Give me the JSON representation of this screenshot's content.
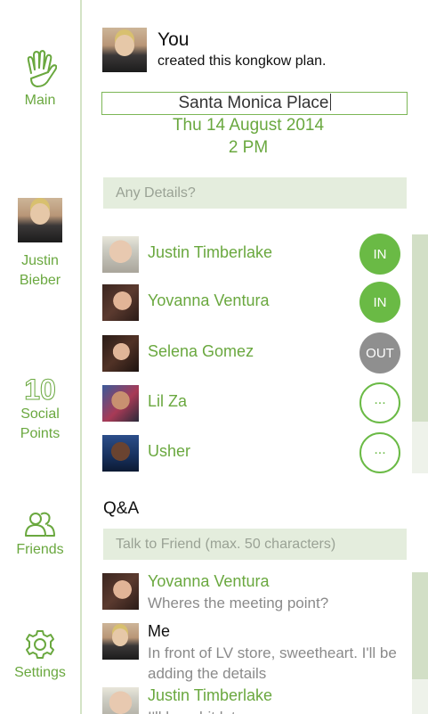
{
  "sidebar": {
    "main": {
      "label": "Main",
      "icon": "hand-icon"
    },
    "profile": {
      "name_line1": "Justin",
      "name_line2": "Bieber"
    },
    "points": {
      "value": "10",
      "label_line1": "Social",
      "label_line2": "Points"
    },
    "friends": {
      "label": "Friends",
      "icon": "friends-icon"
    },
    "settings": {
      "label": "Settings",
      "icon": "gear-icon"
    }
  },
  "creator": {
    "name": "You",
    "action": "created this kongkow plan."
  },
  "plan": {
    "place": "Santa Monica Place",
    "date": "Thu 14 August 2014",
    "time": "2 PM",
    "details_placeholder": "Any Details?"
  },
  "friends": [
    {
      "name": "Justin Timberlake",
      "status": "IN"
    },
    {
      "name": "Yovanna Ventura",
      "status": "IN"
    },
    {
      "name": "Selena Gomez",
      "status": "OUT"
    },
    {
      "name": "Lil Za",
      "status": "..."
    },
    {
      "name": "Usher",
      "status": "..."
    }
  ],
  "qa": {
    "title": "Q&A",
    "input_placeholder": "Talk to Friend (max. 50 characters)",
    "messages": [
      {
        "author": "Yovanna Ventura",
        "text": "Wheres the meeting point?"
      },
      {
        "author": "Me",
        "text": "In front of LV store, sweetheart. I'll be adding the details"
      },
      {
        "author": "Justin Timberlake",
        "text": "I'll be a bit late"
      }
    ]
  },
  "colors": {
    "accent": "#6aa83f",
    "in": "#6aba45",
    "out": "#8f8f8f",
    "field_bg": "#e4eddd"
  }
}
